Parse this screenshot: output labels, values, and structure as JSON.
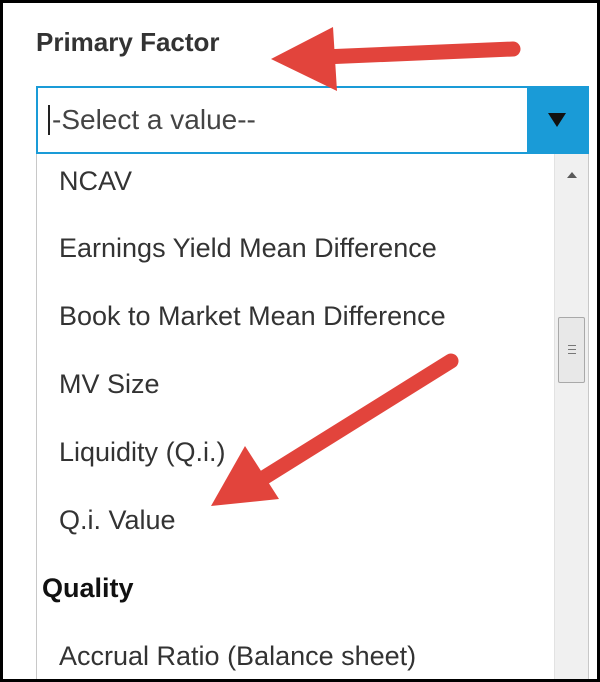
{
  "field": {
    "label": "Primary Factor"
  },
  "select": {
    "value": "-Select a value--"
  },
  "options": [
    "NCAV",
    "Earnings Yield Mean Difference",
    "Book to Market Mean Difference",
    "MV Size",
    "Liquidity (Q.i.)",
    "Q.i. Value"
  ],
  "groups": {
    "quality": {
      "label": "Quality",
      "first_option": "Accrual Ratio (Balance sheet)"
    }
  },
  "colors": {
    "accent": "#1a9bd7",
    "annotation_arrow": "#e2443c",
    "frame": "#000000"
  },
  "icons": {
    "dropdown": "chevron-down-icon",
    "scroll_up": "scroll-up-icon",
    "scroll_thumb": "scroll-thumb-grip-icon"
  }
}
